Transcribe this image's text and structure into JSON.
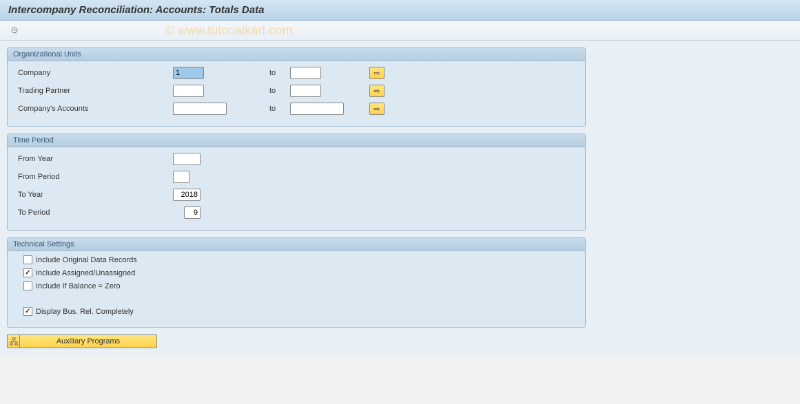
{
  "title": "Intercompany Reconciliation: Accounts: Totals Data",
  "watermark": "© www.tutorialkart.com",
  "groups": {
    "org": {
      "title": "Organizational Units",
      "company_label": "Company",
      "company_value": "1",
      "trading_label": "Trading Partner",
      "accounts_label": "Company's Accounts",
      "to": "to"
    },
    "time": {
      "title": "Time Period",
      "from_year_label": "From Year",
      "from_period_label": "From Period",
      "to_year_label": "To Year",
      "to_year_value": "2018",
      "to_period_label": "To Period",
      "to_period_value": "9"
    },
    "tech": {
      "title": "Technical Settings",
      "original_label": "Include Original Data Records",
      "assigned_label": "Include Assigned/Unassigned",
      "balance_label": "Include If Balance = Zero",
      "busrel_label": "Display Bus. Rel. Completely"
    }
  },
  "aux_button": "Auxiliary Programs"
}
